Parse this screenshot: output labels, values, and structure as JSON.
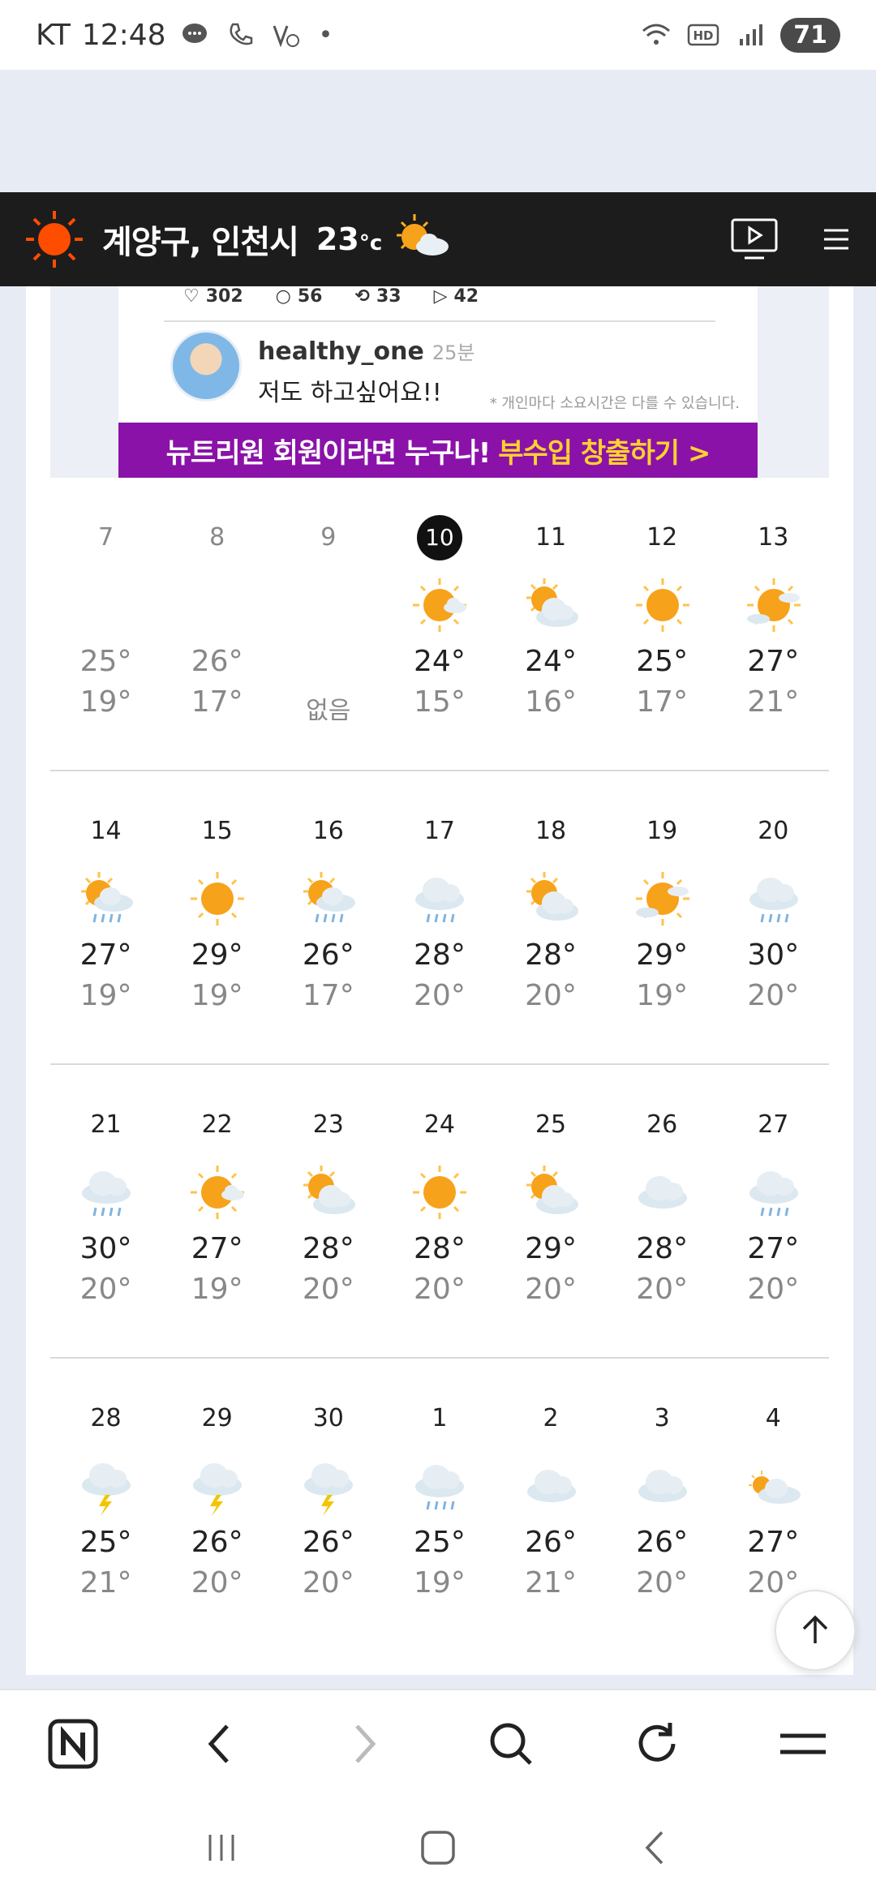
{
  "status_bar": {
    "carrier": "KT",
    "time": "12:48",
    "battery": "71",
    "icons": [
      "chat-icon",
      "call-icon",
      "volte-icon",
      "wifi-icon",
      "hd-icon",
      "signal-icon"
    ]
  },
  "header": {
    "location": "계양구, 인천시",
    "temperature": "23",
    "unit": "°c",
    "weather_icon": "sun-cloud-icon"
  },
  "ad": {
    "likes": "302",
    "comments": "56",
    "reposts": "33",
    "shares": "42",
    "username": "healthy_one",
    "time_ago": "25분",
    "comment": "저도 하고싶어요!!",
    "note": "* 개인마다 소요시간은 다를 수 있습니다.",
    "banner_text": "뉴트리원 회원이라면 누구나!",
    "banner_highlight": "부수입 창출하기 >"
  },
  "calendar": {
    "no_data_text": "없음",
    "weeks": [
      [
        {
          "date": "7",
          "hi": "25°",
          "lo": "19°",
          "icon": "none",
          "past": true
        },
        {
          "date": "8",
          "hi": "26°",
          "lo": "17°",
          "icon": "none",
          "past": true
        },
        {
          "date": "9",
          "hi": "",
          "lo": "",
          "icon": "none",
          "past": true,
          "no_data": true
        },
        {
          "date": "10",
          "hi": "24°",
          "lo": "15°",
          "icon": "sun-small-cloud-icon",
          "today": true
        },
        {
          "date": "11",
          "hi": "24°",
          "lo": "16°",
          "icon": "sun-cloud-icon"
        },
        {
          "date": "12",
          "hi": "25°",
          "lo": "17°",
          "icon": "sun-icon"
        },
        {
          "date": "13",
          "hi": "27°",
          "lo": "21°",
          "icon": "sun-clouds-icon"
        }
      ],
      [
        {
          "date": "14",
          "hi": "27°",
          "lo": "19°",
          "icon": "sun-rain-icon"
        },
        {
          "date": "15",
          "hi": "29°",
          "lo": "19°",
          "icon": "sun-icon"
        },
        {
          "date": "16",
          "hi": "26°",
          "lo": "17°",
          "icon": "sun-rain-icon"
        },
        {
          "date": "17",
          "hi": "28°",
          "lo": "20°",
          "icon": "rain-icon"
        },
        {
          "date": "18",
          "hi": "28°",
          "lo": "20°",
          "icon": "sun-cloud-icon"
        },
        {
          "date": "19",
          "hi": "29°",
          "lo": "19°",
          "icon": "sun-clouds-icon"
        },
        {
          "date": "20",
          "hi": "30°",
          "lo": "20°",
          "icon": "rain-icon"
        }
      ],
      [
        {
          "date": "21",
          "hi": "30°",
          "lo": "20°",
          "icon": "rain-icon"
        },
        {
          "date": "22",
          "hi": "27°",
          "lo": "19°",
          "icon": "sun-small-cloud-icon"
        },
        {
          "date": "23",
          "hi": "28°",
          "lo": "20°",
          "icon": "sun-cloud-icon"
        },
        {
          "date": "24",
          "hi": "28°",
          "lo": "20°",
          "icon": "sun-icon"
        },
        {
          "date": "25",
          "hi": "29°",
          "lo": "20°",
          "icon": "sun-cloud-icon"
        },
        {
          "date": "26",
          "hi": "28°",
          "lo": "20°",
          "icon": "cloud-icon"
        },
        {
          "date": "27",
          "hi": "27°",
          "lo": "20°",
          "icon": "rain-icon"
        }
      ],
      [
        {
          "date": "28",
          "hi": "25°",
          "lo": "21°",
          "icon": "thunder-icon"
        },
        {
          "date": "29",
          "hi": "26°",
          "lo": "20°",
          "icon": "thunder-icon"
        },
        {
          "date": "30",
          "hi": "26°",
          "lo": "20°",
          "icon": "thunder-icon"
        },
        {
          "date": "1",
          "hi": "25°",
          "lo": "19°",
          "icon": "rain-icon"
        },
        {
          "date": "2",
          "hi": "26°",
          "lo": "21°",
          "icon": "cloud-icon"
        },
        {
          "date": "3",
          "hi": "26°",
          "lo": "20°",
          "icon": "cloud-icon"
        },
        {
          "date": "4",
          "hi": "27°",
          "lo": "20°",
          "icon": "small-sun-cloud-icon"
        }
      ]
    ]
  },
  "toolbar": {
    "buttons": [
      "naver-home-icon",
      "back-arrow-icon",
      "forward-arrow-icon",
      "search-icon",
      "refresh-icon",
      "menu-icon"
    ]
  },
  "colors": {
    "header_bg": "#1c1c1c",
    "sun": "#f7a21b",
    "ad_banner": "#8a12a8",
    "ad_highlight": "#ffd22e"
  }
}
